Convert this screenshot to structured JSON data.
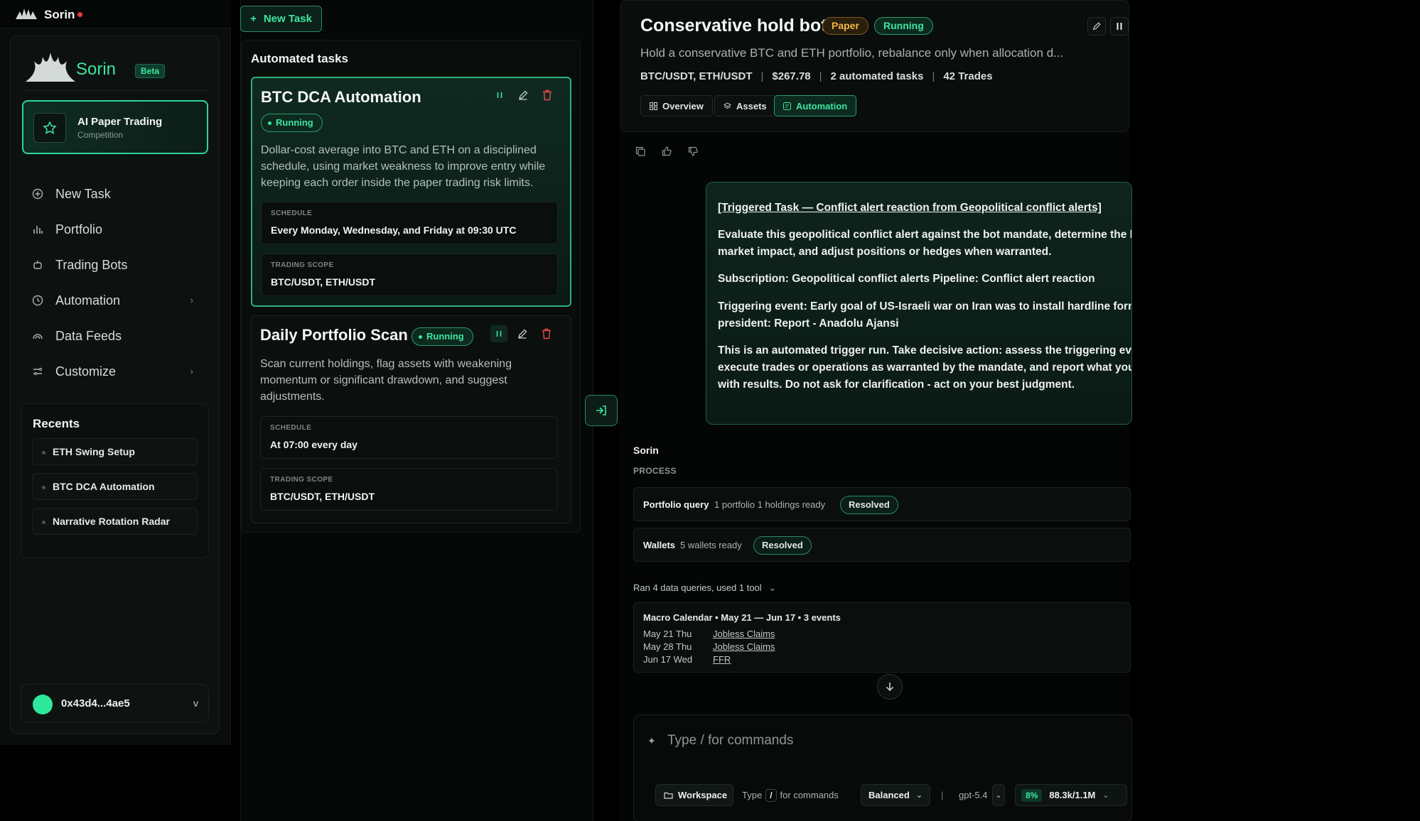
{
  "topbar": {
    "app_name": "Sorin"
  },
  "sidebar": {
    "brand": "Sorin",
    "beta": "Beta",
    "promo": {
      "title": "AI Paper Trading",
      "subtitle": "Competition"
    },
    "nav": [
      {
        "label": "New Task",
        "icon": "plus-square-icon"
      },
      {
        "label": "Portfolio",
        "icon": "bar-chart-icon"
      },
      {
        "label": "Trading Bots",
        "icon": "bot-icon"
      },
      {
        "label": "Automation",
        "icon": "clock-icon"
      },
      {
        "label": "Data Feeds",
        "icon": "signal-icon"
      },
      {
        "label": "Customize",
        "icon": "sliders-icon"
      }
    ],
    "recents_title": "Recents",
    "recents": [
      "ETH Swing Setup",
      "BTC DCA Automation",
      "Narrative Rotation Radar"
    ],
    "wallet": {
      "address": "0x43d4...4ae5",
      "caret": "v"
    }
  },
  "tasks": {
    "new_task_label": "New Task",
    "panel_title": "Automated tasks",
    "items": [
      {
        "name": "BTC DCA Automation",
        "status": "Running",
        "description": "Dollar-cost average into BTC and ETH on a disciplined schedule, using market weakness to improve entry while keeping each order inside the paper trading risk limits.",
        "schedule_label": "SCHEDULE",
        "schedule": "Every Monday, Wednesday, and Friday at 09:30 UTC",
        "scope_label": "TRADING SCOPE",
        "scope": "BTC/USDT, ETH/USDT"
      },
      {
        "name": "Daily Portfolio Scan",
        "status": "Running",
        "description": "Scan current holdings, flag assets with weakening momentum or significant drawdown, and suggest adjustments.",
        "schedule_label": "SCHEDULE",
        "schedule": "At 07:00 every day",
        "scope_label": "TRADING SCOPE",
        "scope": "BTC/USDT, ETH/USDT"
      }
    ]
  },
  "bot": {
    "title": "Conservative hold bot",
    "mode": "Paper",
    "status": "Running",
    "description": "Hold a conservative BTC and ETH portfolio, rebalance only when allocation d...",
    "pairs": "BTC/USDT, ETH/USDT",
    "value": "$267.78",
    "tasks_count": "2 automated tasks",
    "trades": "42 Trades",
    "tabs": [
      "Overview",
      "Assets",
      "Automation"
    ]
  },
  "message": {
    "heading": "[Triggered Task — Conflict alert reaction from Geopolitical conflict alerts]",
    "p1": "Evaluate this geopolitical conflict alert against the bot mandate, determine the likely market impact, and adjust positions or hedges when warranted.",
    "p2": "Subscription: Geopolitical conflict alerts Pipeline: Conflict alert reaction",
    "p3": "Triggering event: Early goal of US-Israeli war on Iran was to install hardline form president: Report - Anadolu Ajansi",
    "p4": "This is an automated trigger run. Take decisive action: assess the triggering ever execute trades or operations as warranted by the mandate, and report what you with results. Do not ask for clarification - act on your best judgment."
  },
  "response": {
    "agent": "Sorin",
    "process_label": "PROCESS",
    "rows": [
      {
        "key": "Portfolio query",
        "value": "1 portfolio 1 holdings ready",
        "badge": "Resolved"
      },
      {
        "key": "Wallets",
        "value": "5 wallets ready",
        "badge": "Resolved"
      }
    ],
    "ran_label": "Ran 4 data queries, used 1 tool",
    "ran_caret": "⌄",
    "macro": {
      "title": "Macro Calendar • May 21 — Jun 17 • 3 events",
      "events": [
        {
          "date": "May 21 Thu",
          "name": "Jobless Claims"
        },
        {
          "date": "May 28 Thu",
          "name": "Jobless Claims"
        },
        {
          "date": "Jun 17 Wed",
          "name": "FFR"
        }
      ]
    }
  },
  "composer": {
    "placeholder": "Type / for commands",
    "workspace": "Workspace",
    "hint_pre": "Type",
    "hint_key": "/",
    "hint_post": "for commands",
    "mode": "Balanced",
    "pipe": "|",
    "model": "gpt-5.4",
    "usage_pct": "8%",
    "usage_tokens": "88.3k/1.1M"
  }
}
